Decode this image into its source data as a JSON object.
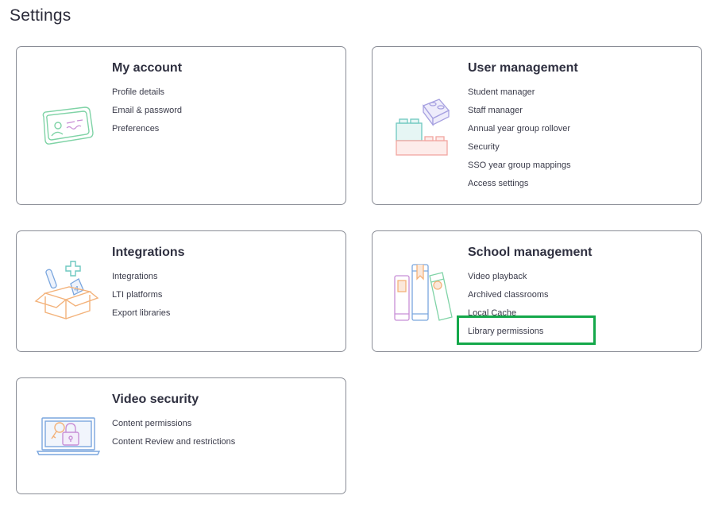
{
  "page": {
    "title": "Settings"
  },
  "cards": {
    "my_account": {
      "title": "My account",
      "links": [
        "Profile details",
        "Email & password",
        "Preferences"
      ],
      "icon": "id-card-icon"
    },
    "user_management": {
      "title": "User management",
      "links": [
        "Student manager",
        "Staff manager",
        "Annual year group rollover",
        "Security",
        "SSO year group mappings",
        "Access settings"
      ],
      "icon": "building-blocks-icon"
    },
    "integrations": {
      "title": "Integrations",
      "links": [
        "Integrations",
        "LTI platforms",
        "Export libraries"
      ],
      "icon": "open-box-icon"
    },
    "school_management": {
      "title": "School management",
      "links": [
        "Video playback",
        "Archived classrooms",
        "Local Cache",
        "Library permissions"
      ],
      "icon": "books-icon"
    },
    "video_security": {
      "title": "Video security",
      "links": [
        "Content permissions",
        "Content Review and restrictions"
      ],
      "icon": "laptop-lock-icon"
    }
  },
  "colors": {
    "highlight": "#14a84a",
    "border": "#8a8d96",
    "mint": "#7fd3a6",
    "lavender": "#a6a0e0",
    "peach": "#f3b27a",
    "coral": "#f2a6a0",
    "teal": "#6ec8c0",
    "blue": "#7aa6de"
  }
}
